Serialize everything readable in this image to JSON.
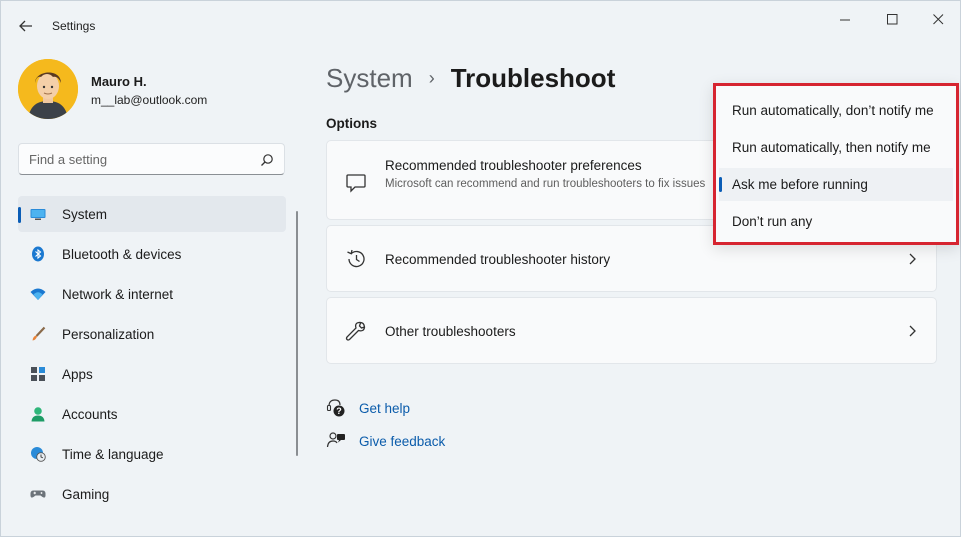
{
  "window": {
    "title": "Settings"
  },
  "user": {
    "name": "Mauro H.",
    "email": "m__lab@outlook.com"
  },
  "search": {
    "placeholder": "Find a setting",
    "value": ""
  },
  "sidebar": {
    "items": [
      {
        "label": "System",
        "icon": "monitor-icon",
        "selected": true
      },
      {
        "label": "Bluetooth & devices",
        "icon": "bluetooth-icon"
      },
      {
        "label": "Network & internet",
        "icon": "wifi-icon"
      },
      {
        "label": "Personalization",
        "icon": "brush-icon"
      },
      {
        "label": "Apps",
        "icon": "apps-icon"
      },
      {
        "label": "Accounts",
        "icon": "person-icon"
      },
      {
        "label": "Time & language",
        "icon": "globe-clock-icon"
      },
      {
        "label": "Gaming",
        "icon": "gamepad-icon"
      }
    ]
  },
  "breadcrumb": {
    "parent": "System",
    "separator": "›",
    "current": "Troubleshoot"
  },
  "main": {
    "section_title": "Options",
    "cards": [
      {
        "title": "Recommended troubleshooter preferences",
        "description": "Microsoft can recommend and run troubleshooters to fix issues",
        "icon": "chat-bubble-icon"
      },
      {
        "title": "Recommended troubleshooter history",
        "icon": "history-icon"
      },
      {
        "title": "Other troubleshooters",
        "icon": "wrench-icon"
      }
    ],
    "links": [
      {
        "label": "Get help",
        "icon": "help-icon"
      },
      {
        "label": "Give feedback",
        "icon": "feedback-icon"
      }
    ]
  },
  "dropdown": {
    "options": [
      "Run automatically, don’t notify me",
      "Run automatically, then notify me",
      "Ask me before running",
      "Don’t run any"
    ],
    "selected_index": 2
  },
  "colors": {
    "accent": "#0a5db6",
    "highlight_border": "#d62430",
    "avatar_bg": "#f5b91d"
  }
}
